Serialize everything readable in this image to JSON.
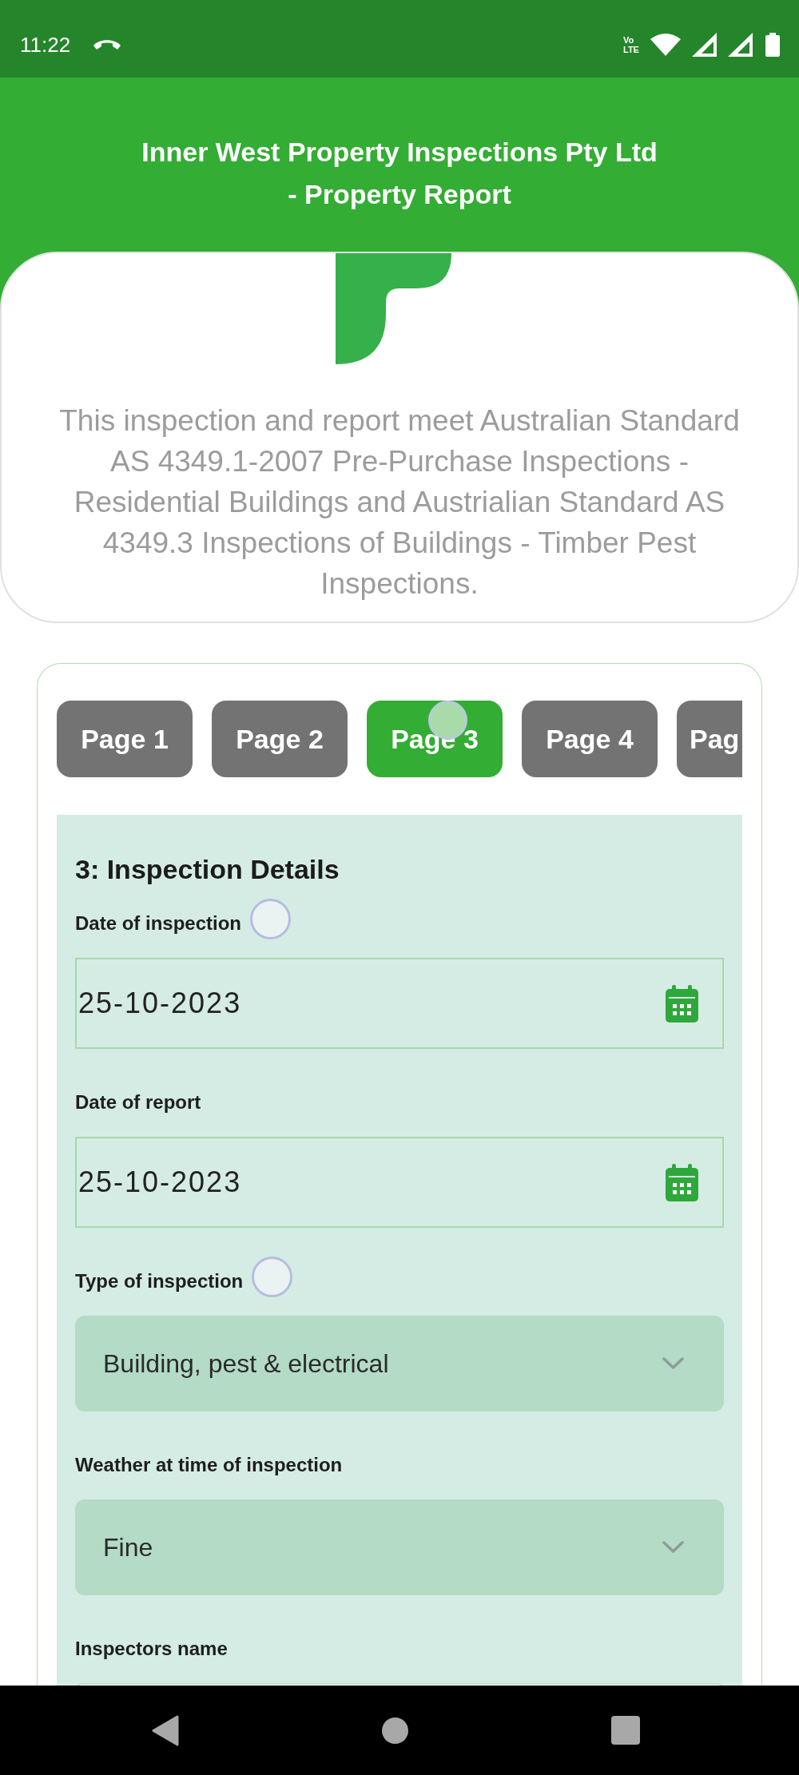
{
  "status_bar": {
    "time": "11:22",
    "network_type": "Vo LTE"
  },
  "header": {
    "title": "Inner West Property Inspections Pty Ltd - Property Report"
  },
  "intro_card": {
    "text": "This inspection and report meet Australian Standard AS 4349.1-2007 Pre-Purchase Inspections - Residential Buildings and Austrialian Standard AS 4349.3 Inspections of Buildings - Timber Pest Inspections."
  },
  "tabs": [
    {
      "label": "Page 1",
      "selected": false,
      "touch_indicator": false
    },
    {
      "label": "Page 2",
      "selected": false,
      "touch_indicator": false
    },
    {
      "label": "Page 3",
      "selected": true,
      "touch_indicator": true
    },
    {
      "label": "Page 4",
      "selected": false,
      "touch_indicator": false
    },
    {
      "label": "Pag",
      "selected": false,
      "touch_indicator": false
    }
  ],
  "section": {
    "title": "3: Inspection Details",
    "fields": [
      {
        "kind": "date",
        "label": "Date of inspection",
        "value": "25-10-2023",
        "touch_indicator": true
      },
      {
        "kind": "date",
        "label": "Date of report",
        "value": "25-10-2023",
        "touch_indicator": false
      },
      {
        "kind": "select",
        "label": "Type of inspection",
        "value": "Building, pest & electrical",
        "touch_indicator": true
      },
      {
        "kind": "select",
        "label": "Weather at time of inspection",
        "value": "Fine",
        "touch_indicator": false
      },
      {
        "kind": "text",
        "label": "Inspectors name",
        "touch_indicator": false
      }
    ]
  }
}
